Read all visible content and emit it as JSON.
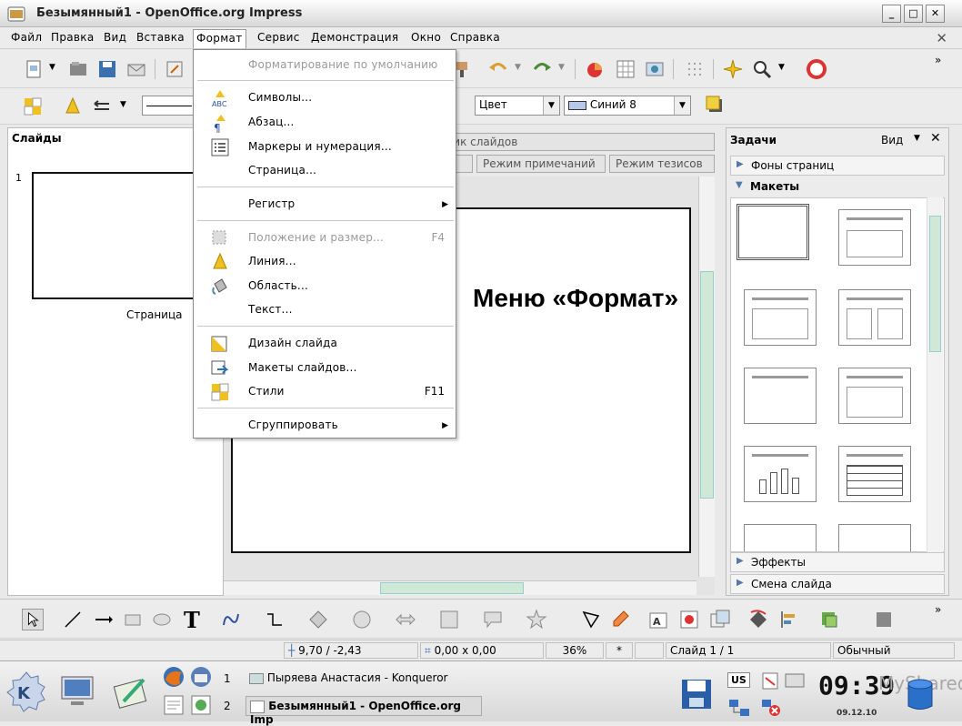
{
  "window": {
    "title": "Безымянный1 - OpenOffice.org Impress",
    "min": "_",
    "max": "□",
    "close": "✕"
  },
  "menubar": [
    "Файл",
    "Правка",
    "Вид",
    "Вставка",
    "Формат",
    "Сервис",
    "Демонстрация",
    "Окно",
    "Справка"
  ],
  "toolbar2": {
    "color_mode": "Цвет",
    "color_name": "Синий 8"
  },
  "slides_pane": {
    "title": "Слайды",
    "slide_number": "1",
    "slide_label": "Страница"
  },
  "view_tabs": {
    "sorter": "щик слайдов",
    "notes": "Режим примечаний",
    "handout": "Режим тезисов"
  },
  "tasks_pane": {
    "title": "Задачи",
    "view": "Вид",
    "sections": {
      "backgrounds": "Фоны страниц",
      "layouts": "Макеты",
      "effects": "Эффекты",
      "transition": "Смена слайда"
    }
  },
  "format_menu": {
    "default": "Форматирование по умолчанию",
    "items": {
      "characters": "Символы...",
      "paragraph": "Абзац...",
      "bullets": "Маркеры и нумерация...",
      "page": "Страница...",
      "case": "Регистр",
      "position": "Положение и размер...",
      "position_key": "F4",
      "line": "Линия...",
      "area": "Область...",
      "text": "Текст...",
      "slide_design": "Дизайн слайда",
      "layouts": "Макеты слайдов...",
      "styles": "Стили",
      "styles_key": "F11",
      "group": "Сгруппировать"
    }
  },
  "caption": "Меню «Формат»",
  "statusbar": {
    "position": "9,70 / -2,43",
    "size": "0,00 x 0,00",
    "zoom": "36%",
    "modified": "*",
    "slide": "Слайд 1 / 1",
    "design": "Обычный"
  },
  "taskbar": {
    "desk1": "1",
    "desk2": "2",
    "task1": "Пыряева Анастасия - Konqueror",
    "task2": "Безымянный1 - OpenOffice.org Imp",
    "lang": "US",
    "time": "09:39",
    "date": "09.12.10",
    "watermark": "MyShared"
  }
}
